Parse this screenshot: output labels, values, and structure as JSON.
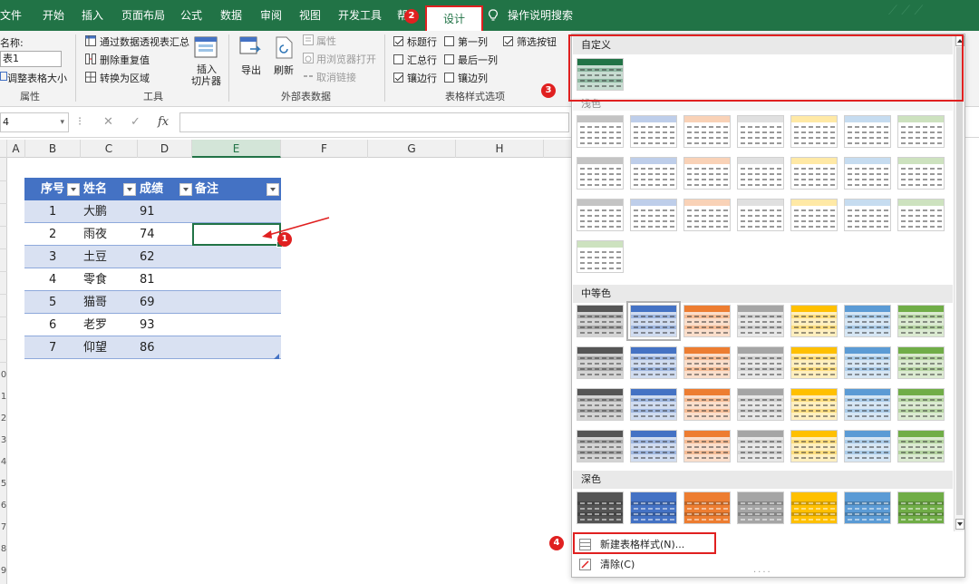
{
  "colors": {
    "excel_green": "#217346",
    "annotation_red": "#e02020",
    "table_header_blue": "#4472c4",
    "table_band_blue": "#d9e1f2"
  },
  "tabs": [
    {
      "label": "文件"
    },
    {
      "label": "开始"
    },
    {
      "label": "插入"
    },
    {
      "label": "页面布局"
    },
    {
      "label": "公式"
    },
    {
      "label": "数据"
    },
    {
      "label": "审阅"
    },
    {
      "label": "视图"
    },
    {
      "label": "开发工具"
    },
    {
      "label": "帮"
    },
    {
      "label": "设计",
      "active": true
    }
  ],
  "tell_me": "操作说明搜索",
  "ribbon": {
    "properties": {
      "name_label": "名称:",
      "name_value": "表1",
      "resize": "调整表格大小",
      "group": "属性"
    },
    "tools": {
      "pivot": "通过数据透视表汇总",
      "remove_dup": "删除重复值",
      "convert": "转换为区域",
      "slicer_line1": "插入",
      "slicer_line2": "切片器",
      "group": "工具"
    },
    "external": {
      "export": "导出",
      "refresh": "刷新",
      "properties": "属性",
      "open_browser": "用浏览器打开",
      "unlink": "取消链接",
      "group": "外部表数据"
    },
    "style_options": {
      "header_row": "标题行",
      "total_row": "汇总行",
      "banded_rows": "镶边行",
      "first_column": "第一列",
      "last_column": "最后一列",
      "banded_columns": "镶边列",
      "filter_button": "筛选按钮",
      "group": "表格样式选项"
    }
  },
  "formula_bar": {
    "cell_ref": "4",
    "fx": "fx"
  },
  "columns": [
    {
      "label": "A"
    },
    {
      "label": "B"
    },
    {
      "label": "C"
    },
    {
      "label": "D"
    },
    {
      "label": "E",
      "selected": true
    },
    {
      "label": "F"
    },
    {
      "label": "G"
    },
    {
      "label": "H"
    }
  ],
  "row_numbers": [
    "0",
    "1",
    "2",
    "3",
    "4",
    "5",
    "6",
    "7",
    "8",
    "9"
  ],
  "table": {
    "headers": [
      "序号",
      "姓名",
      "成绩",
      "备注"
    ],
    "rows": [
      [
        "1",
        "大鹏",
        "91",
        ""
      ],
      [
        "2",
        "雨夜",
        "74",
        ""
      ],
      [
        "3",
        "土豆",
        "62",
        ""
      ],
      [
        "4",
        "零食",
        "81",
        ""
      ],
      [
        "5",
        "猫哥",
        "69",
        ""
      ],
      [
        "6",
        "老罗",
        "93",
        ""
      ],
      [
        "7",
        "仰望",
        "86",
        ""
      ]
    ]
  },
  "annotations": [
    "1",
    "2",
    "3",
    "4"
  ],
  "gallery": {
    "sections": {
      "custom": "自定义",
      "light": "浅色",
      "medium": "中等色",
      "dark": "深色"
    },
    "footer": {
      "new_style": "新建表格样式(N)...",
      "clear": "清除(C)"
    },
    "palette": [
      "#555555",
      "#4472c4",
      "#ed7d31",
      "#a5a5a5",
      "#ffc000",
      "#5b9bd5",
      "#70ad47"
    ]
  }
}
